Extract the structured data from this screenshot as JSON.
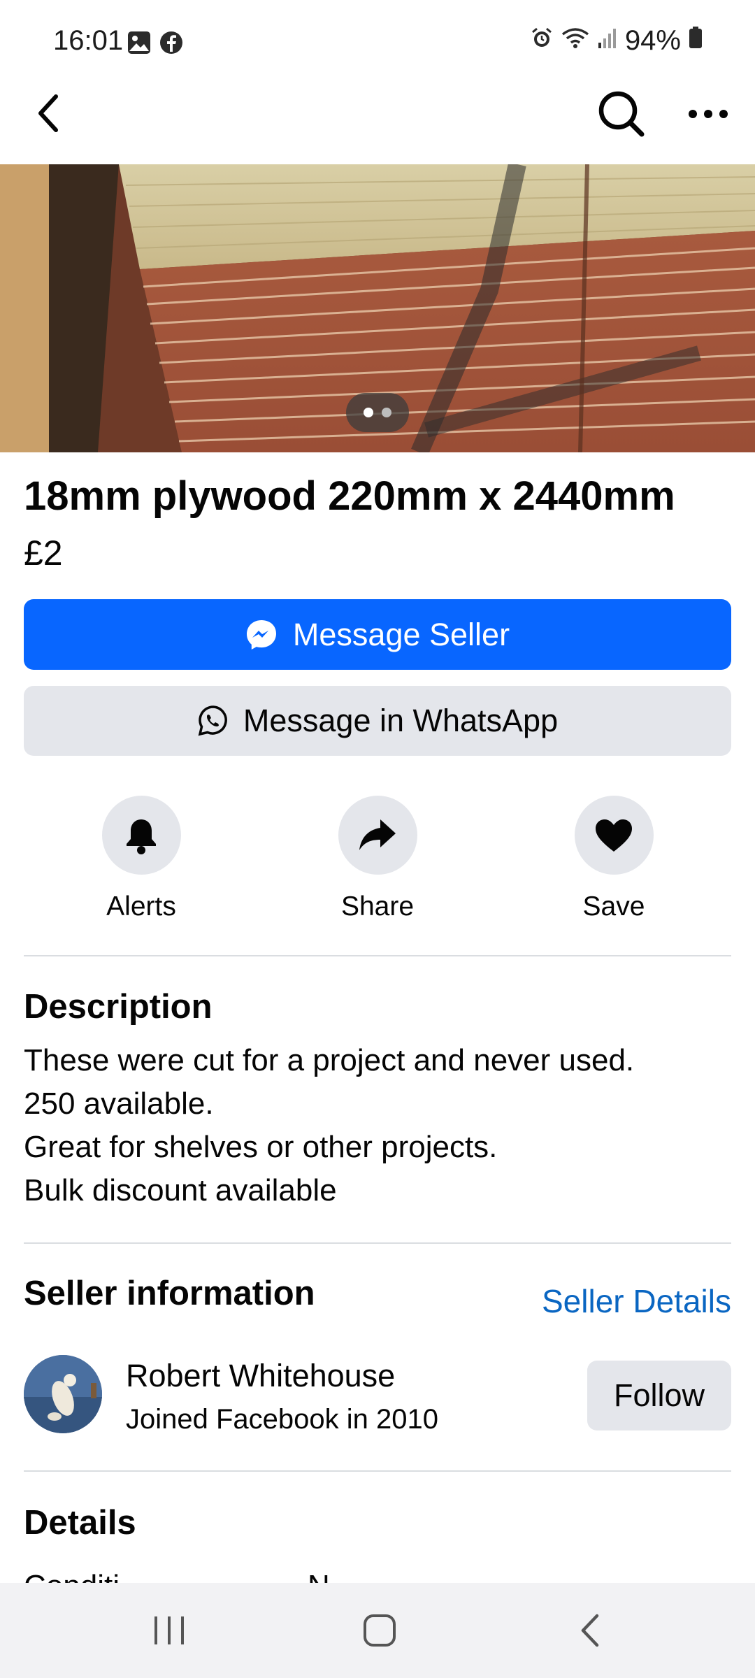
{
  "status_bar": {
    "time": "16:01",
    "battery": "94%",
    "icons_left": [
      "gallery-icon",
      "facebook-icon"
    ],
    "icons_right": [
      "alarm-icon",
      "wifi-icon",
      "signal-icon",
      "battery-icon"
    ]
  },
  "listing": {
    "title": "18mm plywood 220mm x 2440mm",
    "price": "£2",
    "image_count": 2,
    "active_image": 1
  },
  "buttons": {
    "message_seller": "Message Seller",
    "message_whatsapp": "Message in WhatsApp"
  },
  "actions": [
    {
      "label": "Alerts",
      "icon": "bell-icon"
    },
    {
      "label": "Share",
      "icon": "share-icon"
    },
    {
      "label": "Save",
      "icon": "heart-icon"
    }
  ],
  "description": {
    "heading": "Description",
    "lines": [
      "These were cut for a project and never used.",
      "250 available.",
      "Great for shelves or other projects.",
      "Bulk discount available"
    ]
  },
  "seller": {
    "heading": "Seller information",
    "details_link": "Seller Details",
    "name": "Robert Whitehouse",
    "joined": "Joined Facebook in 2010",
    "follow_label": "Follow"
  },
  "details": {
    "heading": "Details",
    "partial_label": "Conditi",
    "partial_value": "N"
  },
  "colors": {
    "primary": "#0866ff",
    "secondary_bg": "#e4e6eb",
    "link": "#0a66c2"
  }
}
